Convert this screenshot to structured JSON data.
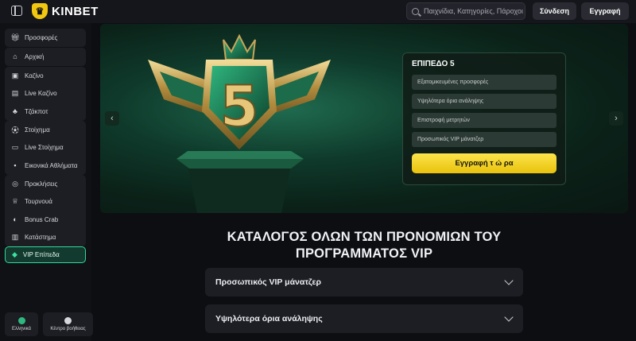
{
  "brand": {
    "name": "KINBET",
    "logo_icon": "crowned-shield-logo",
    "accent": "#f2c711"
  },
  "header": {
    "search_placeholder": "Παιχνίδια, Κατηγορίες, Πάροχοι",
    "login_label": "Σύνδεση",
    "register_label": "Εγγραφή"
  },
  "sidebar": {
    "groups": [
      {
        "items": [
          {
            "label": "Προσφορές",
            "icon": "gift-icon"
          }
        ]
      },
      {
        "items": [
          {
            "label": "Αρχική",
            "icon": "home-icon"
          }
        ]
      },
      {
        "items": [
          {
            "label": "Καζίνο",
            "icon": "slot-machine-icon"
          },
          {
            "label": "Live Καζίνο",
            "icon": "cards-icon"
          },
          {
            "label": "Τζάκποτ",
            "icon": "clover-icon"
          }
        ]
      },
      {
        "items": [
          {
            "label": "Στοίχημα",
            "icon": "soccer-ball-icon"
          },
          {
            "label": "Live Στοίχημα",
            "icon": "live-icon"
          },
          {
            "label": "Εικονικά Αθλήματα",
            "icon": "virtual-sports-icon"
          }
        ]
      },
      {
        "items": [
          {
            "label": "Προκλήσεις",
            "icon": "target-icon"
          },
          {
            "label": "Τουρνουά",
            "icon": "trophy-icon"
          },
          {
            "label": "Bonus Crab",
            "icon": "crab-icon"
          },
          {
            "label": "Κατάστημα",
            "icon": "shop-icon"
          }
        ]
      }
    ],
    "vip": {
      "label": "VIP Επίπεδα",
      "icon": "diamond-icon",
      "color": "#2fd89a"
    },
    "footer": {
      "language_label": "Ελληνικά",
      "help_label": "Κέντρο βοήθειας"
    }
  },
  "banner": {
    "level_title": "ΕΠΙΠΕΔΟ 5",
    "perks": [
      "Εξατομικευμένες προσφορές",
      "Υψηλότερα όρια ανάληψης",
      "Επιστροφή μετρητών",
      "Προσωπικός VIP μάνατζερ"
    ],
    "cta_label": "Εγγραφή τ ώ ρα",
    "badge_number": "5"
  },
  "main": {
    "title": "ΚΑΤΑΛΟΓΟΣ ΟΛΩΝ ΤΩΝ ΠΡΟΝΟΜΙΩΝ ΤΟΥ ΠΡΟΓΡΑΜΜΑΤΟΣ VIP",
    "accordion": [
      "Προσωπικός VIP μάνατζερ",
      "Υψηλότερα όρια ανάληψης"
    ]
  }
}
